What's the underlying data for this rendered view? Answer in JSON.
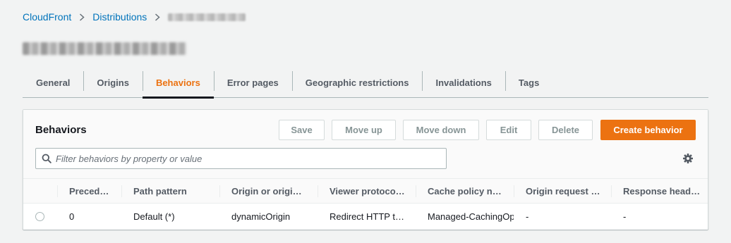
{
  "breadcrumb": {
    "items": [
      "CloudFront",
      "Distributions"
    ]
  },
  "tabs": [
    {
      "label": "General"
    },
    {
      "label": "Origins"
    },
    {
      "label": "Behaviors",
      "active": true
    },
    {
      "label": "Error pages"
    },
    {
      "label": "Geographic restrictions"
    },
    {
      "label": "Invalidations"
    },
    {
      "label": "Tags"
    }
  ],
  "panel": {
    "title": "Behaviors",
    "buttons": {
      "save": "Save",
      "move_up": "Move up",
      "move_down": "Move down",
      "edit": "Edit",
      "delete": "Delete",
      "create": "Create behavior"
    },
    "search": {
      "placeholder": "Filter behaviors by property or value",
      "value": ""
    }
  },
  "table": {
    "columns": [
      "Preced…",
      "Path pattern",
      "Origin or origi…",
      "Viewer protoco…",
      "Cache policy n…",
      "Origin request …",
      "Response head…"
    ],
    "rows": [
      [
        "0",
        "Default (*)",
        "dynamicOrigin",
        "Redirect HTTP t…",
        "Managed-CachingOp",
        "-",
        "-"
      ]
    ]
  },
  "colors": {
    "accent": "#ec7211",
    "link": "#0073bb",
    "tab_inactive": "#545b64",
    "background": "#f2f3f3"
  },
  "icons": {
    "breadcrumb_separator": "chevron-right-icon",
    "search": "search-icon",
    "settings": "gear-icon",
    "row_select": "radio-button"
  }
}
